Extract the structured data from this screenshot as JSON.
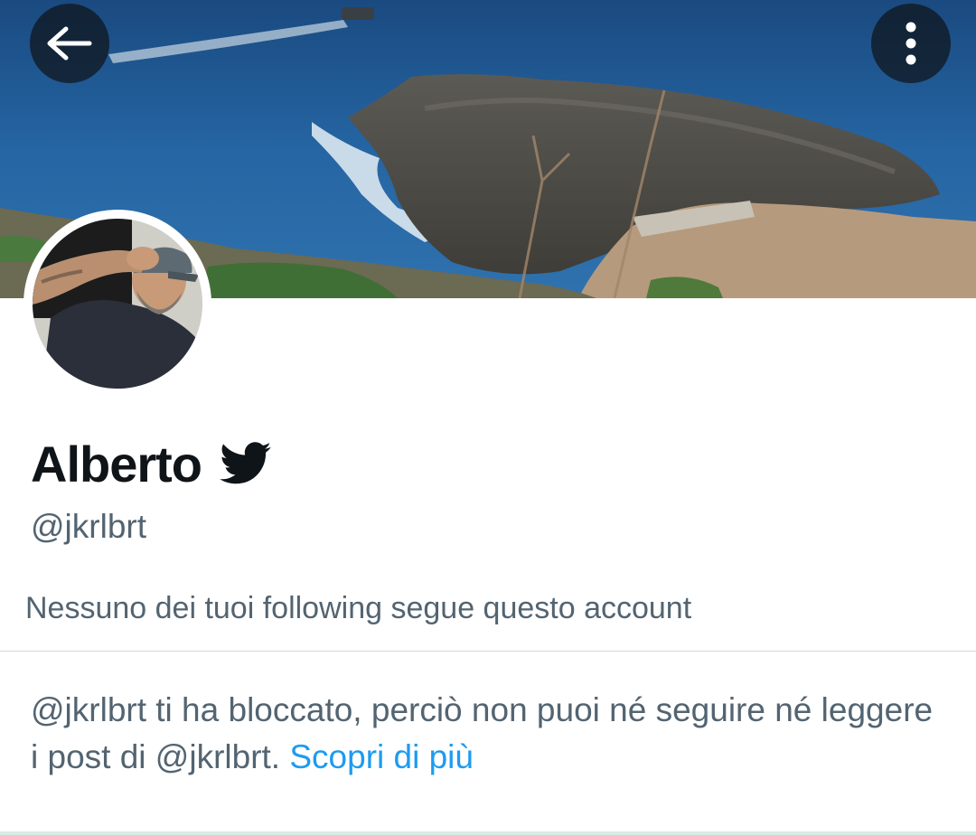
{
  "profile": {
    "display_name": "Alberto",
    "handle": "@jkrlbrt",
    "followers_note": "Nessuno dei tuoi following segue questo account"
  },
  "blocked_notice": {
    "text": "@jkrlbrt ti ha bloccato, perciò non puoi né seguire né leggere i post di @jkrlbrt.",
    "link_label": "Scopri di più"
  },
  "icons": {
    "back": "arrow-left-icon",
    "menu": "more-vertical-icon",
    "badge": "twitter-bird-icon"
  },
  "colors": {
    "link": "#1d9bf0",
    "secondary_text": "#536471",
    "primary_text": "#0f1419"
  }
}
